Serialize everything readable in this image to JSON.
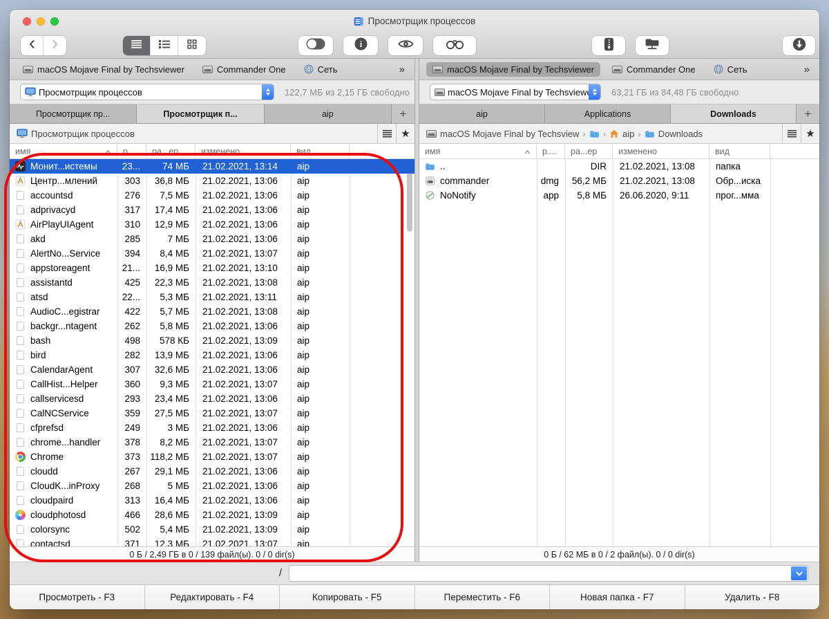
{
  "window": {
    "title": "Просмотрщик процессов"
  },
  "drive_bar": {
    "left": {
      "items": [
        "macOS Mojave Final by Techsviewer",
        "Commander One",
        "Сеть"
      ],
      "icons": [
        "drive",
        "drive",
        "globe"
      ],
      "selected": -1,
      "overflow": "»"
    },
    "right": {
      "items": [
        "macOS Mojave Final by Techsviewer",
        "Commander One",
        "Сеть"
      ],
      "icons": [
        "drive",
        "drive",
        "globe"
      ],
      "selected": 0,
      "overflow": "»"
    }
  },
  "drive_select": {
    "left": {
      "value": "Просмотрщик процессов",
      "free": "122,7 МБ из 2,15 ГБ свободно"
    },
    "right": {
      "value": "macOS Mojave Final by Techsviewer",
      "free": "63,21 ГБ из 84,48 ГБ свободно"
    }
  },
  "tabs": {
    "add_label": "+",
    "left": [
      {
        "label": "Просмотрщик пр...",
        "active": false
      },
      {
        "label": "Просмотрщик п...",
        "active": true
      },
      {
        "label": "aip",
        "active": false
      }
    ],
    "right": [
      {
        "label": "aip",
        "active": false
      },
      {
        "label": "Applications",
        "active": false
      },
      {
        "label": "Downloads",
        "active": true
      }
    ]
  },
  "path_bar": {
    "separator": "›",
    "left": [
      {
        "icon": "display",
        "label": "Просмотрщик процессов"
      }
    ],
    "right": [
      {
        "icon": "drive",
        "label": "macOS Mojave Final by Techsview"
      },
      {
        "icon": "folder",
        "label": ""
      },
      {
        "icon": "home",
        "label": "aip"
      },
      {
        "icon": "folder",
        "label": "Downloads"
      }
    ]
  },
  "columns": [
    {
      "label": "имя",
      "sort": true
    },
    {
      "label": "р...."
    },
    {
      "label": "ра...ер"
    },
    {
      "label": "изменено"
    },
    {
      "label": "вид"
    }
  ],
  "files": {
    "left": [
      {
        "name": "Монит...истемы",
        "p": "23...",
        "size": "74 МБ",
        "modified": "21.02.2021, 13:14",
        "kind": "aip",
        "icon": "activity",
        "selected": true
      },
      {
        "name": "Центр...млений",
        "p": "303",
        "size": "36,8 МБ",
        "modified": "21.02.2021, 13:06",
        "kind": "aip",
        "icon": "goldapp"
      },
      {
        "name": "accountsd",
        "p": "276",
        "size": "7,5 МБ",
        "modified": "21.02.2021, 13:06",
        "kind": "aip",
        "icon": "doc"
      },
      {
        "name": "adprivacyd",
        "p": "317",
        "size": "17,4 МБ",
        "modified": "21.02.2021, 13:06",
        "kind": "aip",
        "icon": "doc"
      },
      {
        "name": "AirPlayUIAgent",
        "p": "310",
        "size": "12,9 МБ",
        "modified": "21.02.2021, 13:06",
        "kind": "aip",
        "icon": "goldapp"
      },
      {
        "name": "akd",
        "p": "285",
        "size": "7 МБ",
        "modified": "21.02.2021, 13:06",
        "kind": "aip",
        "icon": "doc"
      },
      {
        "name": "AlertNo...Service",
        "p": "394",
        "size": "8,4 МБ",
        "modified": "21.02.2021, 13:07",
        "kind": "aip",
        "icon": "doc"
      },
      {
        "name": "appstoreagent",
        "p": "21...",
        "size": "16,9 МБ",
        "modified": "21.02.2021, 13:10",
        "kind": "aip",
        "icon": "doc"
      },
      {
        "name": "assistantd",
        "p": "425",
        "size": "22,3 МБ",
        "modified": "21.02.2021, 13:08",
        "kind": "aip",
        "icon": "doc"
      },
      {
        "name": "atsd",
        "p": "22...",
        "size": "5,3 МБ",
        "modified": "21.02.2021, 13:11",
        "kind": "aip",
        "icon": "doc"
      },
      {
        "name": "AudioC...egistrar",
        "p": "422",
        "size": "5,7 МБ",
        "modified": "21.02.2021, 13:08",
        "kind": "aip",
        "icon": "doc"
      },
      {
        "name": "backgr...ntagent",
        "p": "262",
        "size": "5,8 МБ",
        "modified": "21.02.2021, 13:06",
        "kind": "aip",
        "icon": "doc"
      },
      {
        "name": "bash",
        "p": "498",
        "size": "578 КБ",
        "modified": "21.02.2021, 13:09",
        "kind": "aip",
        "icon": "doc"
      },
      {
        "name": "bird",
        "p": "282",
        "size": "13,9 МБ",
        "modified": "21.02.2021, 13:06",
        "kind": "aip",
        "icon": "doc"
      },
      {
        "name": "CalendarAgent",
        "p": "307",
        "size": "32,6 МБ",
        "modified": "21.02.2021, 13:06",
        "kind": "aip",
        "icon": "doc"
      },
      {
        "name": "CallHist...Helper",
        "p": "360",
        "size": "9,3 МБ",
        "modified": "21.02.2021, 13:07",
        "kind": "aip",
        "icon": "doc"
      },
      {
        "name": "callservicesd",
        "p": "293",
        "size": "23,4 МБ",
        "modified": "21.02.2021, 13:06",
        "kind": "aip",
        "icon": "doc"
      },
      {
        "name": "CalNCService",
        "p": "359",
        "size": "27,5 МБ",
        "modified": "21.02.2021, 13:07",
        "kind": "aip",
        "icon": "doc"
      },
      {
        "name": "cfprefsd",
        "p": "249",
        "size": "3 МБ",
        "modified": "21.02.2021, 13:06",
        "kind": "aip",
        "icon": "doc"
      },
      {
        "name": "chrome...handler",
        "p": "378",
        "size": "8,2 МБ",
        "modified": "21.02.2021, 13:07",
        "kind": "aip",
        "icon": "doc"
      },
      {
        "name": "Chrome",
        "p": "373",
        "size": "118,2 МБ",
        "modified": "21.02.2021, 13:07",
        "kind": "aip",
        "icon": "chrome"
      },
      {
        "name": "cloudd",
        "p": "267",
        "size": "29,1 МБ",
        "modified": "21.02.2021, 13:06",
        "kind": "aip",
        "icon": "doc"
      },
      {
        "name": "CloudK...inProxy",
        "p": "268",
        "size": "5 МБ",
        "modified": "21.02.2021, 13:06",
        "kind": "aip",
        "icon": "doc"
      },
      {
        "name": "cloudpaird",
        "p": "313",
        "size": "16,4 МБ",
        "modified": "21.02.2021, 13:06",
        "kind": "aip",
        "icon": "doc"
      },
      {
        "name": "cloudphotosd",
        "p": "466",
        "size": "28,6 МБ",
        "modified": "21.02.2021, 13:09",
        "kind": "aip",
        "icon": "photos"
      },
      {
        "name": "colorsync",
        "p": "502",
        "size": "5,4 МБ",
        "modified": "21.02.2021, 13:09",
        "kind": "aip",
        "icon": "doc"
      },
      {
        "name": "contactsd",
        "p": "371",
        "size": "12,3 МБ",
        "modified": "21.02.2021, 13:07",
        "kind": "aip",
        "icon": "doc"
      }
    ],
    "right": [
      {
        "name": "..",
        "p": "",
        "size": "DIR",
        "modified": "21.02.2021, 13:08",
        "kind": "папка",
        "icon": "folder"
      },
      {
        "name": "commander",
        "p": "dmg",
        "size": "56,2 МБ",
        "modified": "21.02.2021, 13:08",
        "kind": "Обр...иска",
        "icon": "dmg"
      },
      {
        "name": "NoNotify",
        "p": "app",
        "size": "5,8 МБ",
        "modified": "26.06.2020, 9:11",
        "kind": "прог...мма",
        "icon": "nonotify"
      }
    ]
  },
  "status": {
    "left": "0 Б / 2,49 ГБ в 0 / 139 файл(ы). 0 / 0 dir(s)",
    "right": "0 Б / 62 МБ в 0 / 2 файл(ы). 0 / 0 dir(s)"
  },
  "command": {
    "prompt": "/",
    "value": ""
  },
  "fkeys": [
    "Просмотреть - F3",
    "Редактировать - F4",
    "Копировать - F5",
    "Переместить - F6",
    "Новая папка - F7",
    "Удалить - F8"
  ],
  "colors": {
    "selection": "#2062d4",
    "annotation": "#e60e0e",
    "stepper_blue": "#2e75f2"
  }
}
